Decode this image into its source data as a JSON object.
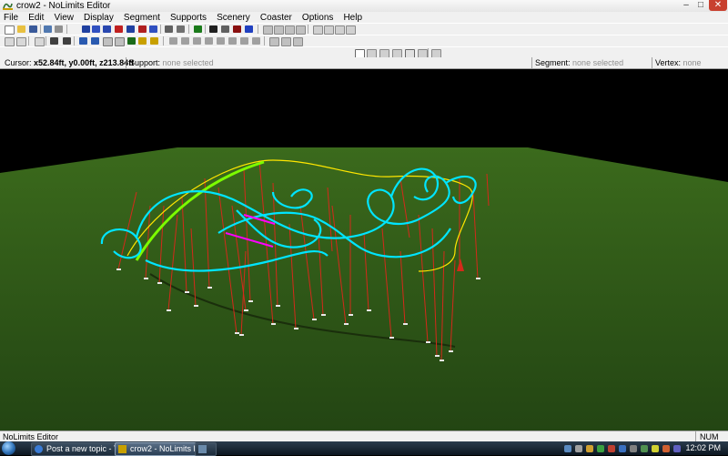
{
  "window": {
    "title": "crow2 - NoLimits Editor",
    "minimize": "–",
    "maximize": "□",
    "close": "✕"
  },
  "menu": [
    "File",
    "Edit",
    "View",
    "Display",
    "Segment",
    "Supports",
    "Scenery",
    "Coaster",
    "Options",
    "Help"
  ],
  "status_row": {
    "cursor_label": "Cursor:",
    "cursor_value": "x52.84ft, y0.00ft, z213.84ft",
    "support_label": "Support:",
    "support_value": "none selected",
    "segment_label": "Segment:",
    "segment_value": "none selected",
    "vertex_label": "Vertex:",
    "vertex_value": "none selected"
  },
  "app_status": {
    "left": "NoLimits Editor",
    "right": "NUM"
  },
  "taskbar": {
    "tasks": [
      {
        "label": "Post a new topic - T...",
        "active": false
      },
      {
        "label": "crow2 - NoLimits Ed...",
        "active": true
      },
      {
        "label": "",
        "active": false
      }
    ],
    "clock": "12:02 PM"
  },
  "colors": {
    "ground": "#2f5516",
    "sky": "#000000",
    "track": "#00e5ff",
    "rail_green": "#7cfc00",
    "rail_yellow": "#ffe600",
    "supports": "#d42a1a",
    "selected": "#ff00ff"
  }
}
